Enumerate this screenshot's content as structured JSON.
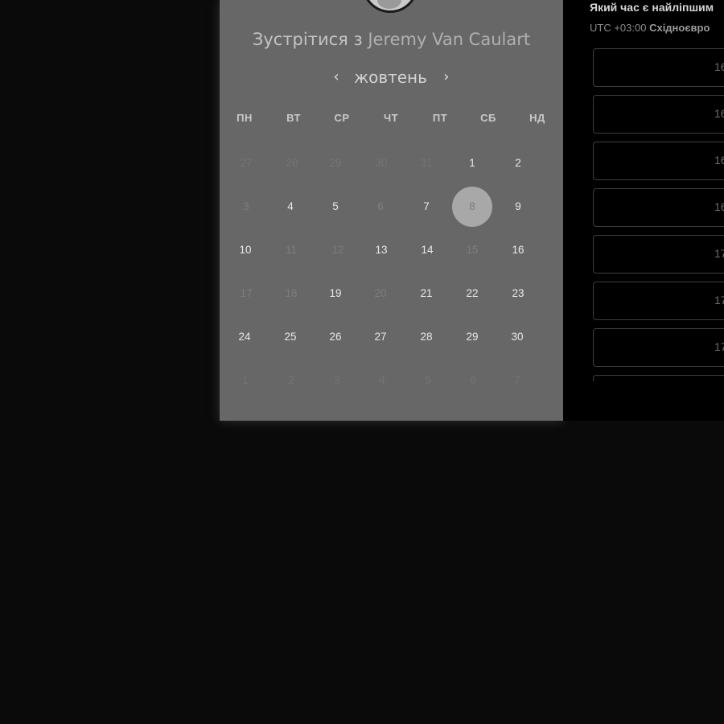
{
  "booking": {
    "title_prefix": "Зустрітися з",
    "host_name": "Jeremy Van Caulart"
  },
  "calendar": {
    "month": "жовтень",
    "prev_arrow": "‹",
    "next_arrow": "›",
    "weekdays": [
      "ПН",
      "ВТ",
      "СР",
      "ЧТ",
      "ПТ",
      "СБ",
      "НД"
    ],
    "selected_day": "8",
    "weeks": [
      [
        "27",
        "28",
        "29",
        "30",
        "31",
        "1",
        "2"
      ],
      [
        "3",
        "4",
        "5",
        "6",
        "7",
        "8",
        "9"
      ],
      [
        "10",
        "11",
        "12",
        "13",
        "14",
        "15",
        "16"
      ],
      [
        "17",
        "18",
        "19",
        "20",
        "21",
        "22",
        "23"
      ],
      [
        "24",
        "25",
        "26",
        "27",
        "28",
        "29",
        "30"
      ],
      [
        "1",
        "2",
        "3",
        "4",
        "5",
        "6",
        "7"
      ]
    ]
  },
  "time_panel": {
    "question": "Який час є найліпшим",
    "tz_offset": "UTC +03:00",
    "tz_name": "Східноєвро",
    "slots": [
      "16",
      "16",
      "16",
      "16",
      "17",
      "17",
      "17"
    ]
  }
}
